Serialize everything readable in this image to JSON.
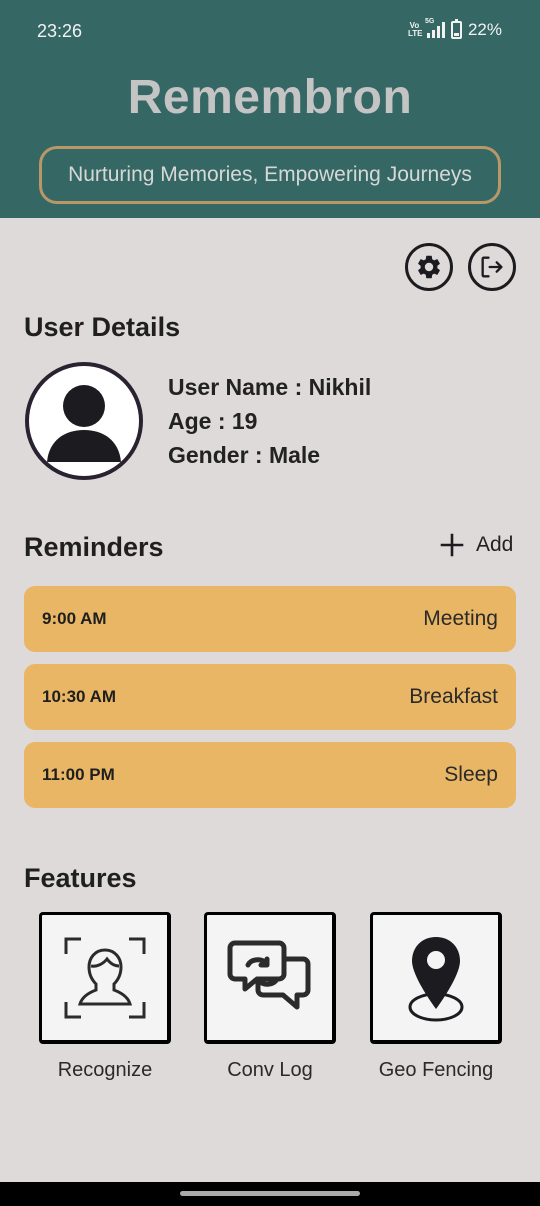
{
  "status": {
    "time": "23:26",
    "volte": "Vo LTE",
    "network": "5G",
    "battery": "22%"
  },
  "header": {
    "title": "Remembron",
    "tagline": "Nurturing Memories, Empowering Journeys"
  },
  "actions": {
    "settings_icon": "gear-icon",
    "logout_icon": "logout-icon"
  },
  "user_details": {
    "title": "User Details",
    "name": "User Name : Nikhil",
    "age": "Age : 19",
    "gender": "Gender : Male"
  },
  "reminders": {
    "title": "Reminders",
    "add_label": "Add",
    "items": [
      {
        "time": "9:00 AM",
        "label": "Meeting"
      },
      {
        "time": "10:30 AM",
        "label": "Breakfast"
      },
      {
        "time": "11:00 PM",
        "label": "Sleep"
      }
    ]
  },
  "features": {
    "title": "Features",
    "items": [
      {
        "label": "Recognize",
        "icon": "face-scan-icon"
      },
      {
        "label": "Conv Log",
        "icon": "chat-bubbles-icon"
      },
      {
        "label": "Geo Fencing",
        "icon": "location-pin-icon"
      }
    ]
  },
  "colors": {
    "header_bg": "#356865",
    "page_bg": "#dedad9",
    "reminder_bg": "#e8b665",
    "tagline_border": "#b89768"
  }
}
